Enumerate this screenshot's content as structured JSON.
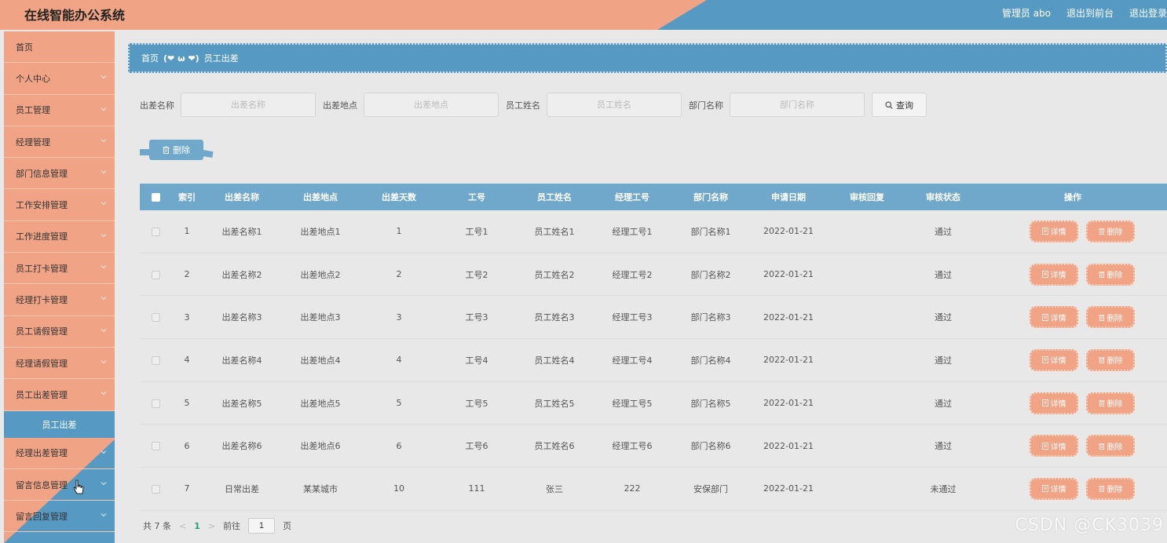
{
  "header": {
    "title": "在线智能办公系统",
    "user": "管理员 abo",
    "to_front": "退出到前台",
    "logout": "退出登录"
  },
  "sidebar": {
    "items": [
      {
        "label": "首页",
        "chevron": false
      },
      {
        "label": "个人中心",
        "chevron": true
      },
      {
        "label": "员工管理",
        "chevron": true
      },
      {
        "label": "经理管理",
        "chevron": true
      },
      {
        "label": "部门信息管理",
        "chevron": true
      },
      {
        "label": "工作安排管理",
        "chevron": true
      },
      {
        "label": "工作进度管理",
        "chevron": true
      },
      {
        "label": "员工打卡管理",
        "chevron": true
      },
      {
        "label": "经理打卡管理",
        "chevron": true
      },
      {
        "label": "员工请假管理",
        "chevron": true
      },
      {
        "label": "经理请假管理",
        "chevron": true
      },
      {
        "label": "员工出差管理",
        "chevron": true
      }
    ],
    "active_sub": "员工出差",
    "items_after": [
      {
        "label": "经理出差管理",
        "chevron": true
      },
      {
        "label": "留言信息管理",
        "chevron": true
      },
      {
        "label": "留言回复管理",
        "chevron": true
      }
    ]
  },
  "breadcrumb": {
    "home": "首页",
    "separator": "(❤ ω ❤)",
    "current": "员工出差"
  },
  "search": {
    "fields": [
      {
        "label": "出差名称",
        "placeholder": "出差名称"
      },
      {
        "label": "出差地点",
        "placeholder": "出差地点"
      },
      {
        "label": "员工姓名",
        "placeholder": "员工姓名"
      },
      {
        "label": "部门名称",
        "placeholder": "部门名称"
      }
    ],
    "query_label": "查询"
  },
  "batch_delete_label": "删除",
  "table": {
    "headers": [
      "索引",
      "出差名称",
      "出差地点",
      "出差天数",
      "工号",
      "员工姓名",
      "经理工号",
      "部门名称",
      "申请日期",
      "审核回复",
      "审核状态",
      "操作"
    ],
    "rows": [
      [
        "1",
        "出差名称1",
        "出差地点1",
        "1",
        "工号1",
        "员工姓名1",
        "经理工号1",
        "部门名称1",
        "2022-01-21",
        "",
        "通过"
      ],
      [
        "2",
        "出差名称2",
        "出差地点2",
        "2",
        "工号2",
        "员工姓名2",
        "经理工号2",
        "部门名称2",
        "2022-01-21",
        "",
        "通过"
      ],
      [
        "3",
        "出差名称3",
        "出差地点3",
        "3",
        "工号3",
        "员工姓名3",
        "经理工号3",
        "部门名称3",
        "2022-01-21",
        "",
        "通过"
      ],
      [
        "4",
        "出差名称4",
        "出差地点4",
        "4",
        "工号4",
        "员工姓名4",
        "经理工号4",
        "部门名称4",
        "2022-01-21",
        "",
        "通过"
      ],
      [
        "5",
        "出差名称5",
        "出差地点5",
        "5",
        "工号5",
        "员工姓名5",
        "经理工号5",
        "部门名称5",
        "2022-01-21",
        "",
        "通过"
      ],
      [
        "6",
        "出差名称6",
        "出差地点6",
        "6",
        "工号6",
        "员工姓名6",
        "经理工号6",
        "部门名称6",
        "2022-01-21",
        "",
        "通过"
      ],
      [
        "7",
        "日常出差",
        "某某城市",
        "10",
        "111",
        "张三",
        "222",
        "安保部门",
        "2022-01-21",
        "",
        "未通过"
      ]
    ],
    "detail_label": "详情",
    "delete_label": "删除"
  },
  "pager": {
    "total": "共 7 条",
    "prev": "<",
    "current_page": "1",
    "next": ">",
    "goto_prefix": "前往",
    "goto_value": "1",
    "goto_suffix": "页"
  },
  "watermark": "CSDN @CK3039",
  "colors": {
    "salmon": "#f0a485",
    "blue": "#5699c2",
    "table_header": "#6fa8ca",
    "page_bg": "#e8e8e8"
  }
}
